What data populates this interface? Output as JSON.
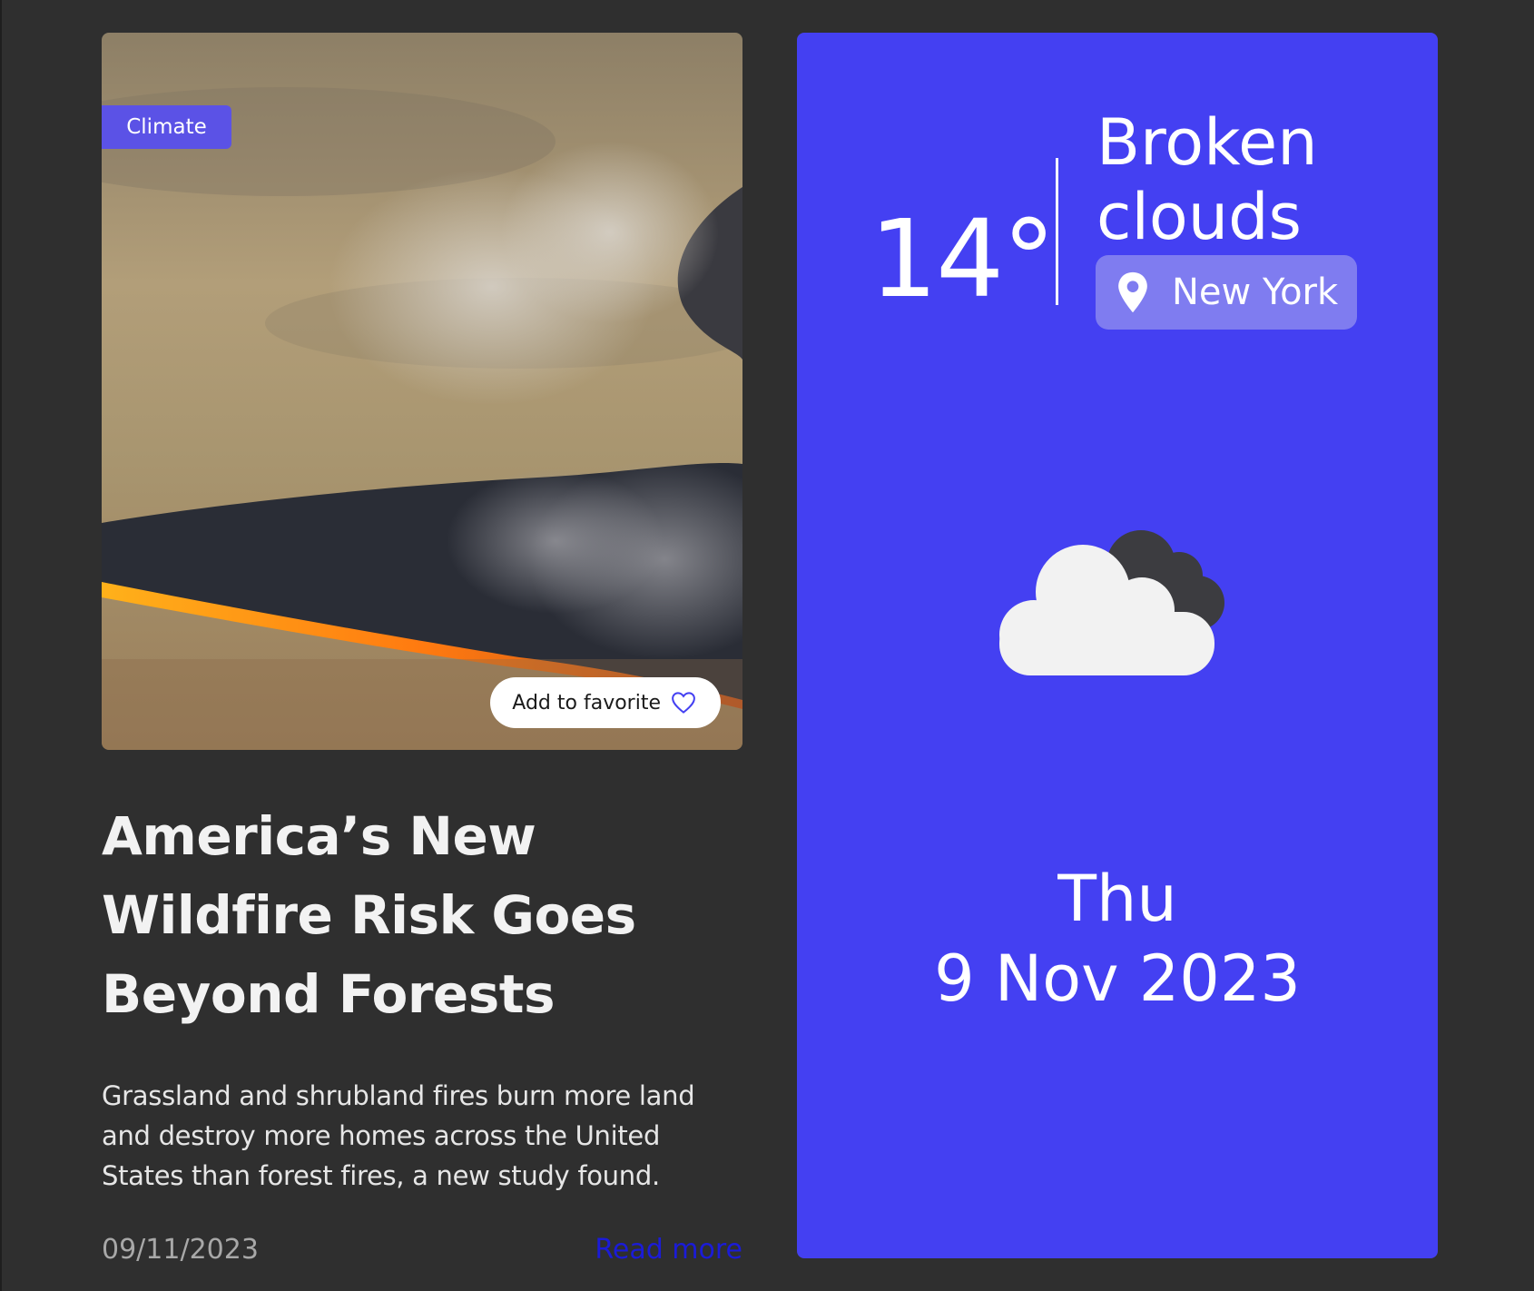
{
  "news": {
    "category": "Climate",
    "favorite_label": "Add to favorite",
    "title": "America’s New Wildfire Risk Goes Beyond Forests",
    "summary": "Grassland and shrubland fires burn more land and destroy more homes across the United States than forest fires, a new study found.",
    "date": "09/11/2023",
    "read_more_label": "Read more"
  },
  "weather": {
    "temperature": "14°",
    "condition": "Broken clouds",
    "location": "New York",
    "day": "Thu",
    "date": "9 Nov 2023",
    "icon": "broken-clouds-icon"
  },
  "colors": {
    "page_background": "#2f2f2f",
    "weather_card": "#4440f2",
    "badge": "#5b52e6",
    "location_chip": "#7f7cf0",
    "read_more": "#1b1bd8"
  }
}
